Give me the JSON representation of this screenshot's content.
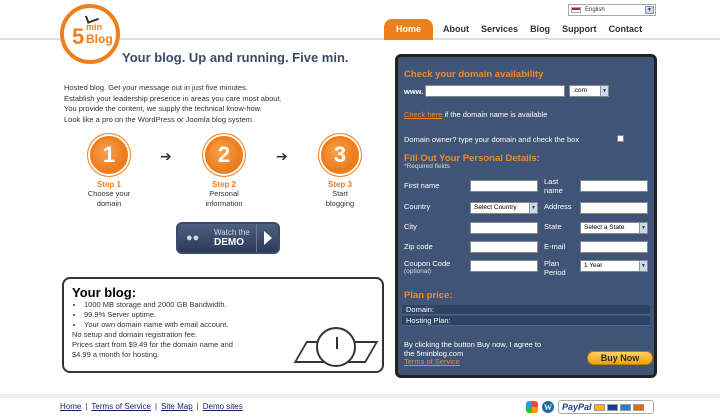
{
  "logo": {
    "digit": "5",
    "min": "min",
    "blog": "Blog"
  },
  "language": {
    "selected": "English"
  },
  "nav": [
    "Home",
    "About",
    "Services",
    "Blog",
    "Support",
    "Contact"
  ],
  "tagline": "Your blog. Up and running. Five min.",
  "intro": [
    "Hosted blog. Get your message out in just five minutes.",
    "Establish your leadership presence in areas you care most about.",
    "You provide the content, we supply the technical know-how.",
    "Look like a pro on the WordPress or Joomla blog system."
  ],
  "steps": [
    {
      "num": "1",
      "title": "Step 1",
      "line1": "Choose your",
      "line2": "domain"
    },
    {
      "num": "2",
      "title": "Step 2",
      "line1": "Personal",
      "line2": "information"
    },
    {
      "num": "3",
      "title": "Step 3",
      "line1": "Start",
      "line2": "blogging"
    }
  ],
  "demo": {
    "line1": "Watch the",
    "line2": "DEMO"
  },
  "blog": {
    "title": "Your blog:",
    "bullets": [
      "1000 MB storage and 2000 GB Bandwidth.",
      "99.9% Server uptime.",
      "Your own domain name with email account."
    ],
    "line1": "No setup and domain registration fee.",
    "line2": "Prices start from $9.49 for the domain name and",
    "line3": "$4.99 a month for hosting."
  },
  "domain": {
    "title": "Check your domain availability",
    "prefix": "www.",
    "tld": ".com",
    "check_link": "Check here",
    "check_text": " if the domain name is available",
    "owner_text": "Domain owner? type your domain and check the box"
  },
  "personal": {
    "title": "Fill Out Your Personal Details:",
    "required": "*Required fields",
    "first_name": "First name",
    "last_name_1": "Last",
    "last_name_2": "name",
    "country": "Country",
    "country_select": "Select Country",
    "address": "Address",
    "city": "City",
    "state": "State",
    "state_select": "Select a State",
    "zip": "Zip code",
    "email": "E-mail",
    "coupon": "Coupon Code",
    "optional": "(optional)",
    "plan_1": "Plan",
    "plan_2": "Period",
    "plan_select": "1 Year"
  },
  "price": {
    "title": "Plan price:",
    "domain": "Domain:",
    "hosting": "Hosting Plan:"
  },
  "agree": {
    "line1": "By clicking the button Buy now, I agree to",
    "line2": "the 5minblog.com",
    "terms": "Terms of Service"
  },
  "buy_label": "Buy Now",
  "footer": [
    "Home",
    "Terms of Service",
    "Site Map",
    "Demo sites"
  ],
  "paypal_label": "PayPal"
}
